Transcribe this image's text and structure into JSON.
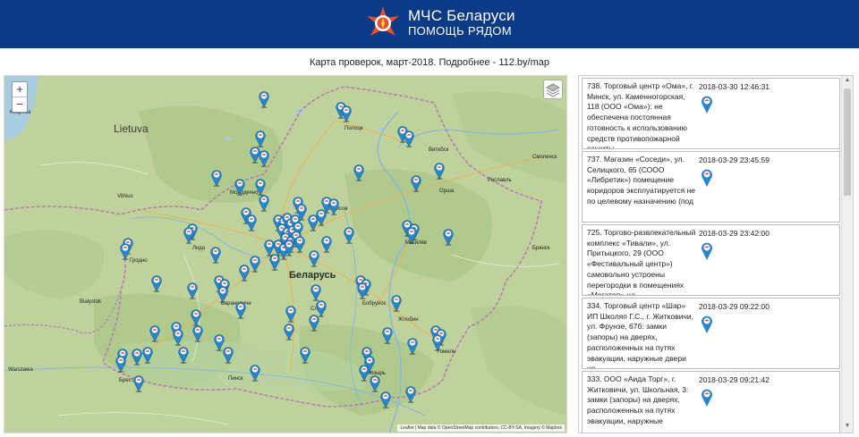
{
  "header": {
    "line1": "МЧС Беларуси",
    "line2": "ПОМОЩЬ РЯДОМ",
    "bg_color": "#0b3a86"
  },
  "caption": "Карта проверок, март-2018. Подробнее - 112.by/map",
  "map": {
    "zoom_in": "+",
    "zoom_out": "−",
    "attribution": "Leaflet | Map data © OpenStreetMap contributors, CC-BY-SA, Imagery © Mapbox",
    "labels": {
      "lietuva": "Lietuva",
      "belarus": "Беларусь",
      "klaipeda": "Klaipeda",
      "vilnius": "Vilnius",
      "bialystok": "Bialystok",
      "warszawa": "Warszawa",
      "brest": "Брест",
      "pinsk": "Пинск",
      "grodno": "Гродно",
      "lida": "Лида",
      "baranovichi": "Барановичи",
      "slutsk": "Слуцк",
      "bobruisk": "Бобруйск",
      "mogilev": "Могилёв",
      "zhlobin": "Жлобин",
      "gomel": "Гомель",
      "mozyr": "Мозырь",
      "vitebsk": "Витебск",
      "polotsk": "Полоцк",
      "orsha": "Орша",
      "smolensk": "Смоленск",
      "roslavl": "Рославль",
      "bryansk": "Брянск",
      "borisov": "Борисов",
      "molodechno": "Молодечно"
    },
    "marker_color": "#2a86c8",
    "marker_count": 96
  },
  "entries": [
    {
      "text": "738. Торговый центр «Ома», г. Минск, ул. Каменногорская, 118 (ООО «Ома»): не обеспечена постоянная готовность к использованию средств противопожарной защиты",
      "date": "2018-03-30 12:46:31"
    },
    {
      "text": "737. Магазин «Соседи», ул. Селицкого, 65 (СООО «Либретик») помещение коридоров эксплуатируется не по целевому назначению (под",
      "date": "2018-03-29 23:45:59"
    },
    {
      "text": "725. Торгово-развлекательный комплекс «Тивали», ул. Притыцкого, 29 (ООО «Фестивальный центр») самовольно устроены перегородки в помещениях «Мегатоп» на",
      "date": "2018-03-29 23:42:00"
    },
    {
      "text": "334. Торговый центр «Шар» ИП Школяп Г.С., г. Житковичи, ул. Фрунзе, 67б: замки (запоры) на дверях, расположенных на путях эвакуации, наружные двери не",
      "date": "2018-03-29 09:22:00"
    },
    {
      "text": "333. ООО «Аида Торг», г. Житковичи, ул. Школьная, 3: замки (запоры) на дверях, расположенных на путях эвакуации, наружные",
      "date": "2018-03-29 09:21:42"
    }
  ]
}
